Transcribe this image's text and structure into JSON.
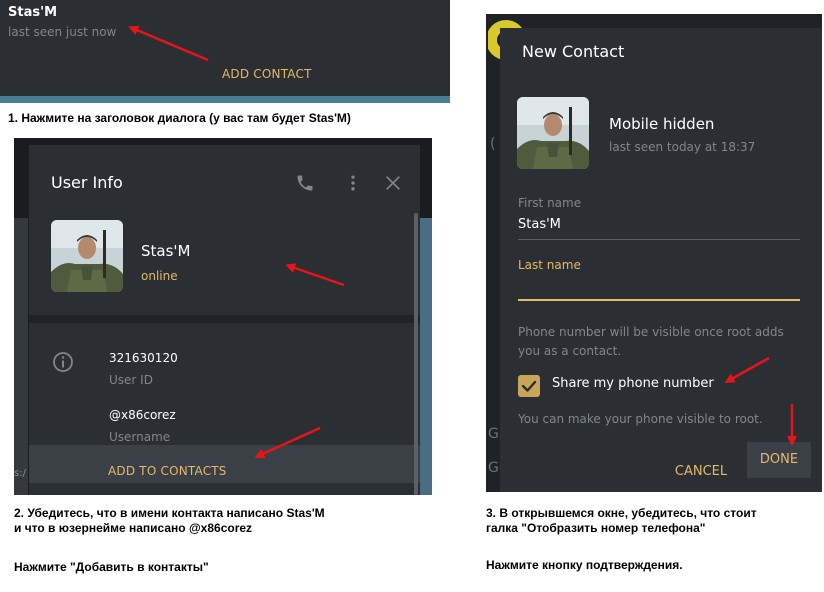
{
  "panel1": {
    "contact_name": "Stas'M",
    "status": "last seen just now",
    "add_contact": "ADD CONTACT",
    "caption": "1. Нажмите на заголовок диалога (у вас там будет Stas'M)"
  },
  "panel2": {
    "title": "User Info",
    "name": "Stas'M",
    "status": "online",
    "user_id": "321630120",
    "user_id_label": "User ID",
    "username": "@x86corez",
    "username_label": "Username",
    "add_to_contacts": "ADD TO CONTACTS",
    "edge_text": "s:/",
    "caption_line1": "2. Убедитесь, что в имени контакта написано Stas'M",
    "caption_line2": "и что в юзернейме написано @x86corez",
    "caption_line3": "Нажмите \"Добавить в контакты\""
  },
  "panel3": {
    "title": "New Contact",
    "phone": "Mobile hidden",
    "last_seen": "last seen today at 18:37",
    "first_name_label": "First name",
    "first_name_value": "Stas'M",
    "last_name_label": "Last name",
    "note": "Phone number will be visible once root adds you as a contact.",
    "share_label": "Share my phone number",
    "share_checked": true,
    "visible_note": "You can make your phone visible to root.",
    "cancel": "CANCEL",
    "done": "DONE",
    "edge_chars": [
      "(",
      "G",
      "G"
    ],
    "caption_line1": "3. В открывшемся окне, убедитесь, что стоит",
    "caption_line2": "галка \"Отобразить номер телефона\"",
    "caption_line3": "Нажмите кнопку подтверждения."
  },
  "colors": {
    "dialog_bg": "#2b2f34",
    "accent": "#e3b96a",
    "muted": "#80868c",
    "arrow": "#e8141a"
  },
  "icons": [
    "phone-icon",
    "more-vertical-icon",
    "close-icon",
    "info-icon",
    "checkmark-icon",
    "arrow-annotation"
  ]
}
